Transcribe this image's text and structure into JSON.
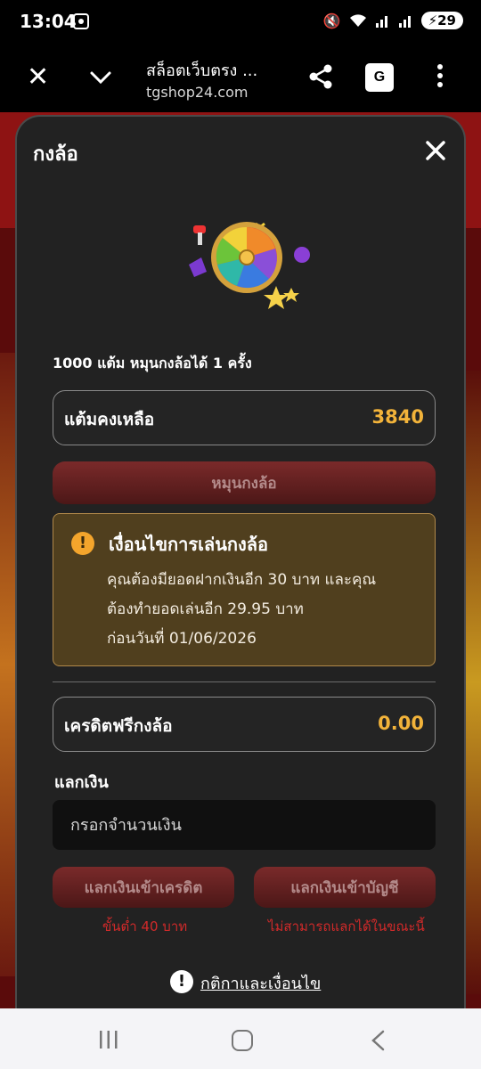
{
  "status_bar": {
    "time": "13:04",
    "battery": "29"
  },
  "browser": {
    "title": "สล็อตเว็บตรง ...",
    "url": "tgshop24.com"
  },
  "modal": {
    "title": "กงล้อ",
    "points_rule": "1000 แต้ม หมุนกงล้อได้ 1 ครั้ง",
    "points_label": "แต้มคงเหลือ",
    "points_value": "3840",
    "spin_button": "หมุนกงล้อ",
    "warning": {
      "title": "เงื่อนไขการเล่นกงล้อ",
      "lines": [
        "คุณต้องมียอดฝากเงินอีก 30 บาท และคุณ",
        "ต้องทำยอดเล่นอีก 29.95 บาท",
        "ก่อนวันที่ 01/06/2026"
      ]
    },
    "credit_label": "เครดิตฟรีกงล้อ",
    "credit_value": "0.00",
    "exchange_label": "แลกเงิน",
    "amount_placeholder": "กรอกจำนวนเงิน",
    "exchange_credit_button": "แลกเงินเข้าเครดิต",
    "exchange_credit_note": "ขั้นต่ำ 40 บาท",
    "exchange_account_button": "แลกเงินเข้าบัญชี",
    "exchange_account_note": "ไม่สามารถแลกได้ในขณะนี้",
    "terms_link": "กติกาและเงื่อนไข"
  },
  "colors": {
    "accent_gold": "#f2b33a",
    "warning_bg": "#503f1e",
    "error_red": "#d12a2a"
  }
}
